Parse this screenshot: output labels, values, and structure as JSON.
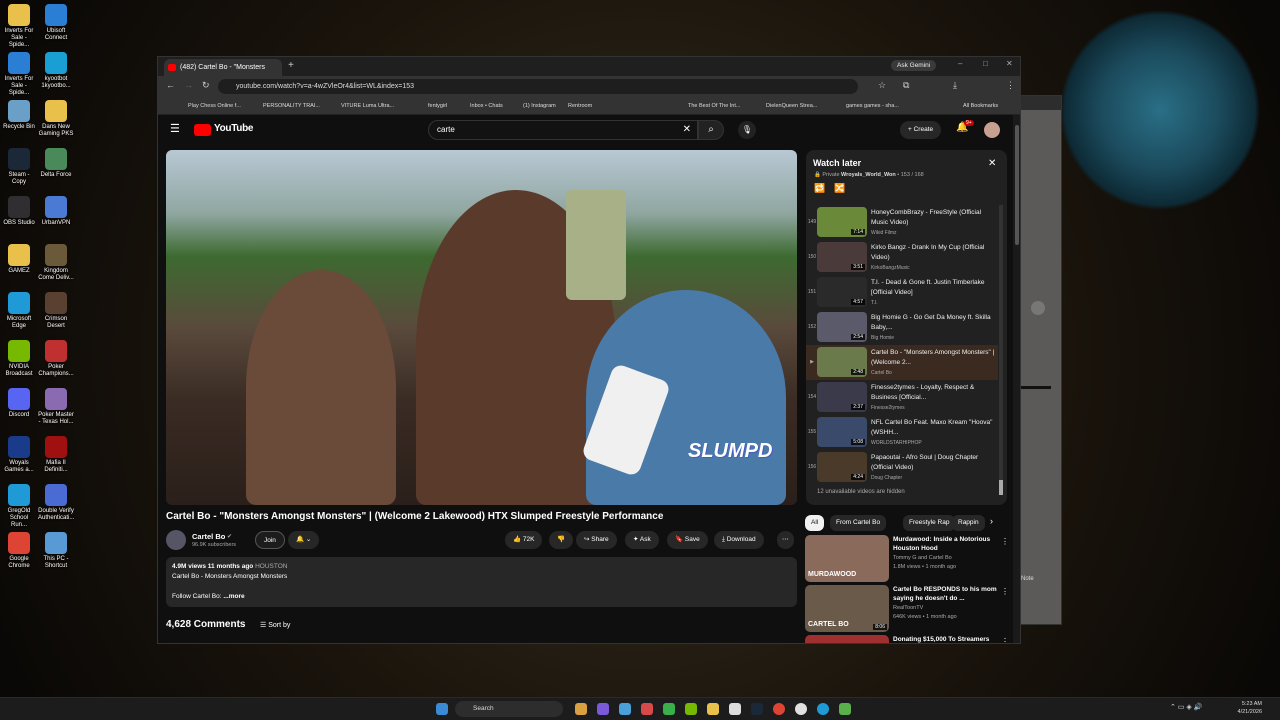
{
  "desktop": {
    "icons": [
      {
        "label": "Inverts For Sale - Spide...",
        "color": "#e8c04a"
      },
      {
        "label": "Ubisoft Connect",
        "color": "#2a7fd4"
      },
      {
        "label": "Inverts For Sale - Spide...",
        "color": "#2a7fd4"
      },
      {
        "label": "kyootbot 1kyootbo...",
        "color": "#1a9fd4"
      },
      {
        "label": "Recycle Bin",
        "color": "#6aa0c8"
      },
      {
        "label": "Dans New Gaming PKS",
        "color": "#e8c04a"
      },
      {
        "label": "Steam - Copy",
        "color": "#1b2838"
      },
      {
        "label": "Delta Force",
        "color": "#4a8a5a"
      },
      {
        "label": "OBS Studio",
        "color": "#302e31"
      },
      {
        "label": "UrbanVPN",
        "color": "#4a7ad4"
      },
      {
        "label": "GAMEZ",
        "color": "#e8c04a"
      },
      {
        "label": "Kingdom Come Deliv...",
        "color": "#6b5a3a"
      },
      {
        "label": "Microsoft Edge",
        "color": "#1f9ad6"
      },
      {
        "label": "Crimson Desert",
        "color": "#5a4030"
      },
      {
        "label": "NVIDIA Broadcast",
        "color": "#76b900"
      },
      {
        "label": "Poker Champions...",
        "color": "#c03030"
      },
      {
        "label": "Discord",
        "color": "#5865f2"
      },
      {
        "label": "Poker Master - Texas Hol...",
        "color": "#8a6ab0"
      },
      {
        "label": "Woyals Games a...",
        "color": "#1a3a8a"
      },
      {
        "label": "Mafia II Definiti...",
        "color": "#a01010"
      },
      {
        "label": "GregOld School Run...",
        "color": "#1f9ad6"
      },
      {
        "label": "Double Verify Authenticati...",
        "color": "#4a6ad4"
      },
      {
        "label": "Google Chrome",
        "color": "#dd4433"
      },
      {
        "label": "This PC - Shortcut",
        "color": "#5a9ad4"
      }
    ]
  },
  "browser": {
    "tab_title": "(482) Cartel Bo - \"Monsters",
    "ask_gemini": "Ask Gemini",
    "url": "youtube.com/watch?v=a-4wZVleOr4&list=WL&index=153",
    "bookmarks": [
      "Play Chess Online f...",
      "PERSONALITY TRAI...",
      "VITURE Luma Ultra...",
      "fentygirl",
      "Inbox • Chats",
      "(1) Instagram",
      "Rentroom",
      "The Best Of The Int...",
      "DielenQueen Strea...",
      "games games - sha...",
      "All Bookmarks"
    ]
  },
  "youtube": {
    "logo": "YouTube",
    "search_value": "carte",
    "create_label": "Create",
    "notif_count": "9+",
    "video_title": "Cartel Bo - \"Monsters Amongst Monsters\" | (Welcome 2 Lakewood) HTX Slumped Freestyle Performance",
    "watermark": "SLUMPD",
    "channel": "Cartel Bo",
    "subscribers": "96.9K subscribers",
    "join": "Join",
    "likes": "72K",
    "share": "Share",
    "ask": "Ask",
    "save": "Save",
    "download": "Download",
    "views_line": "4.9M views  11 months ago",
    "hashtag": "HOUSTON",
    "desc_line": "Cartel Bo - Monsters Amongst Monsters",
    "follow_line": "Follow Cartel Bo:",
    "more": "...more",
    "comments": "4,628 Comments",
    "sort_by": "Sort by",
    "watch_later": {
      "title": "Watch later",
      "privacy": "Private",
      "owner": "Wroyals_World_Won",
      "position": "153 / 168",
      "items": [
        {
          "num": "149",
          "title": "HoneyCombBrazy - FreeStyle (Official Music Video)",
          "channel": "Wikid Filmz",
          "dur": "7:14",
          "color": "#6a8a3a"
        },
        {
          "num": "150",
          "title": "Kirko Bangz - Drank In My Cup (Official Video)",
          "channel": "KirkoBangzMusic",
          "dur": "3:51",
          "color": "#4a3a3a"
        },
        {
          "num": "151",
          "title": "T.I. - Dead & Gone ft. Justin Timberlake [Official Video]",
          "channel": "T.I.",
          "dur": "4:57",
          "color": "#2a2a2a"
        },
        {
          "num": "152",
          "title": "Big Homie G - Go Get Da Money ft. Skilla Baby,...",
          "channel": "Big Homie",
          "dur": "2:54",
          "color": "#5a5a6a"
        },
        {
          "num": "▶",
          "title": "Cartel Bo - \"Monsters Amongst Monsters\" | (Welcome 2...",
          "channel": "Cartel Bo",
          "dur": "2:48",
          "color": "#6a7a4a"
        },
        {
          "num": "154",
          "title": "Finesse2tymes - Loyalty, Respect & Business [Official...",
          "channel": "Finesse2tymes",
          "dur": "2:37",
          "color": "#3a3a4a"
        },
        {
          "num": "155",
          "title": "NFL Cartel Bo Feat. Maxo Kream \"Hoova\" (WSHH...",
          "channel": "WORLDSTARHIPHOP",
          "dur": "5:08",
          "color": "#3a4a6a"
        },
        {
          "num": "156",
          "title": "Papaoutai - Afro Soul | Doug Chapter (Official Video)",
          "channel": "Doug Chapter",
          "dur": "4:24",
          "color": "#4a3a2a"
        }
      ],
      "hidden_note": "12 unavailable videos are hidden"
    },
    "chips": [
      "All",
      "From Cartel Bo",
      "Freestyle Rap",
      "Rappin"
    ],
    "recommended": [
      {
        "title": "Murdawood: Inside a Notorious Houston Hood",
        "channel": "Tommy G and Cartel Bo",
        "meta": "1.8M views • 1 month ago",
        "overlay": "MURDAWOOD",
        "dur": "",
        "color": "#8a6a5a"
      },
      {
        "title": "Cartel Bo RESPONDS to his mom saying he doesn't do ...",
        "channel": "RealToonTV",
        "meta": "646K views • 1 month ago",
        "overlay": "CARTEL BO",
        "dur": "8:06",
        "color": "#6a5a4a"
      },
      {
        "title": "Donating $15,000 To Streamers",
        "channel": "",
        "meta": "",
        "overlay": "",
        "dur": "",
        "color": "#a03030"
      }
    ]
  },
  "taskbar": {
    "search": "Search",
    "time": "5:23 AM",
    "date": "4/21/2026"
  }
}
